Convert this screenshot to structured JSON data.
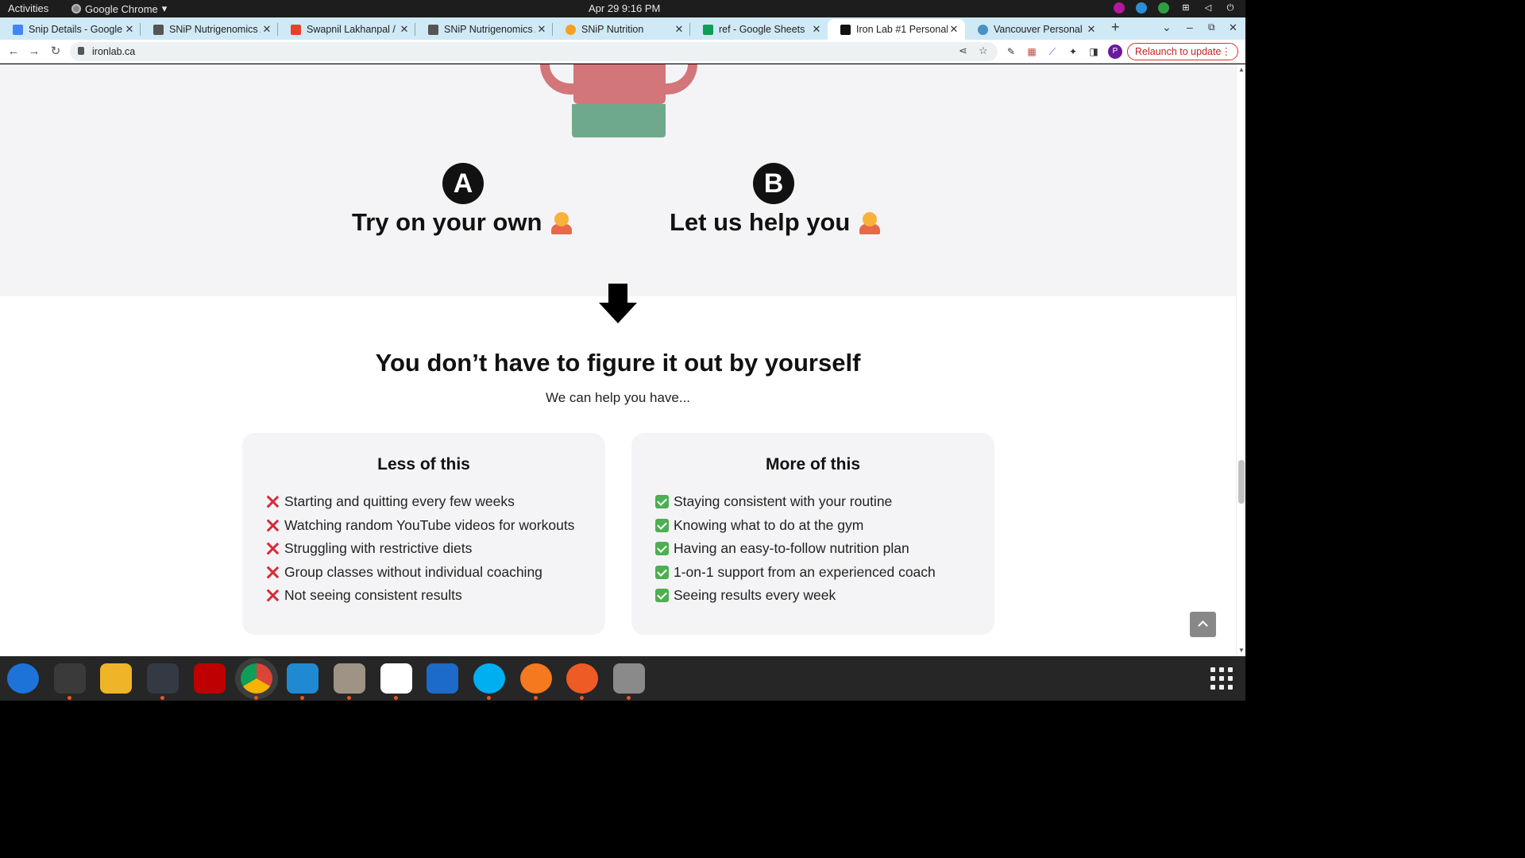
{
  "system": {
    "activities": "Activities",
    "app_name": "Google Chrome",
    "clock": "Apr 29  9:16 PM"
  },
  "tabs": [
    {
      "title": "Snip Details - Google",
      "favicon_color": "#4285f4"
    },
    {
      "title": "SNiP Nutrigenomics A",
      "favicon_color": "#555555"
    },
    {
      "title": "Swapnil Lakhanpal / S",
      "favicon_color": "#e24329"
    },
    {
      "title": "SNiP Nutrigenomics A",
      "favicon_color": "#555555"
    },
    {
      "title": "SNiP Nutrition",
      "favicon_color": "#f4a020"
    },
    {
      "title": "ref - Google Sheets",
      "favicon_color": "#0f9d58"
    },
    {
      "title": "Iron Lab #1 Personal",
      "favicon_color": "#111111",
      "active": true
    },
    {
      "title": "Vancouver Personal T",
      "favicon_color": "#4a90c2"
    }
  ],
  "toolbar": {
    "url": "ironlab.ca",
    "relaunch_label": "Relaunch to update",
    "profile_initial": "P"
  },
  "page": {
    "option_a": {
      "badge": "A",
      "title": "Try on your own"
    },
    "option_b": {
      "badge": "B",
      "title": "Let us help you"
    },
    "heading": "You don’t have to figure it out by yourself",
    "subheading": "We can help you have...",
    "less": {
      "title": "Less of this",
      "items": [
        "Starting and quitting every few weeks",
        "Watching random YouTube videos for workouts",
        "Struggling with restrictive diets",
        "Group classes without individual coaching",
        "Not seeing consistent results"
      ]
    },
    "more": {
      "title": "More of this",
      "items": [
        "Staying consistent with your routine",
        "Knowing what to do at the gym",
        "Having an easy-to-follow nutrition plan",
        "1-on-1 support from an experienced coach",
        "Seeing results every week"
      ]
    }
  },
  "dock": [
    {
      "icon": "thunderbird-icon",
      "color": "#1e73d8",
      "running": false
    },
    {
      "icon": "terminal-icon",
      "color": "#3a3a3a",
      "running": true
    },
    {
      "icon": "calculator-icon",
      "color": "#f0b429",
      "running": false
    },
    {
      "icon": "system-monitor-icon",
      "color": "#333a44",
      "running": true
    },
    {
      "icon": "filezilla-icon",
      "color": "#bf0000",
      "running": false
    },
    {
      "icon": "chrome-icon",
      "color": "#db4437",
      "running": true
    },
    {
      "icon": "vscode-icon",
      "color": "#1f8ad2",
      "running": true
    },
    {
      "icon": "files-icon",
      "color": "#9e9385",
      "running": true
    },
    {
      "icon": "text-editor-icon",
      "color": "#ffffff",
      "running": true
    },
    {
      "icon": "writer-icon",
      "color": "#1c6ac9",
      "running": false
    },
    {
      "icon": "skype-icon",
      "color": "#00aff0",
      "running": true
    },
    {
      "icon": "hotspot-icon",
      "color": "#f4791f",
      "running": true
    },
    {
      "icon": "postman-icon",
      "color": "#ef5b25",
      "running": true
    },
    {
      "icon": "disk-icon",
      "color": "#8a8a8a",
      "running": true
    }
  ]
}
